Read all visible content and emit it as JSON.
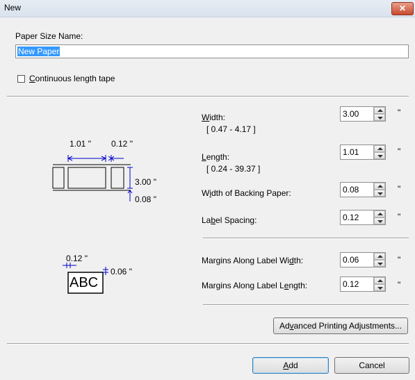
{
  "window": {
    "title": "New",
    "close_glyph": "✕"
  },
  "form": {
    "paper_size_name_label": "Paper Size Name:",
    "paper_size_name_value": "New Paper",
    "continuous_tape": {
      "label_pre": "",
      "label_u": "C",
      "label_post": "ontinuous length tape",
      "checked": false
    }
  },
  "fields": {
    "width": {
      "label_u": "W",
      "label_post": "idth:",
      "range": "[ 0.47 - 4.17 ]",
      "value": "3.00",
      "unit": "\""
    },
    "length": {
      "label_u": "L",
      "label_post": "ength:",
      "range": "[ 0.24 - 39.37 ]",
      "value": "1.01",
      "unit": "\""
    },
    "backing": {
      "label_pre": "W",
      "label_u": "i",
      "label_post": "dth of Backing Paper:",
      "value": "0.08",
      "unit": "\""
    },
    "spacing": {
      "label_pre": "La",
      "label_u": "b",
      "label_post": "el Spacing:",
      "value": "0.12",
      "unit": "\""
    },
    "margin_width": {
      "label_pre": "Margins Along Label Wi",
      "label_u": "d",
      "label_post": "th:",
      "value": "0.06",
      "unit": "\""
    },
    "margin_length": {
      "label_pre": "Margins Along Label L",
      "label_u": "e",
      "label_post": "ngth:",
      "value": "0.12",
      "unit": "\""
    }
  },
  "diagram": {
    "dim_length": "1.01 \"",
    "dim_spacing": "0.12 \"",
    "dim_width": "3.00 \"",
    "dim_backing": "0.08 \"",
    "dim_margin_w": "0.12 \"",
    "dim_margin_l": "0.06 \"",
    "sample_text": "ABC"
  },
  "buttons": {
    "advanced": {
      "pre": "Ad",
      "u": "v",
      "post": "anced Printing Adjustments..."
    },
    "add": {
      "pre": "",
      "u": "A",
      "post": "dd"
    },
    "cancel": "Cancel"
  },
  "colors": {
    "accent_blue": "#3399ff",
    "dimension_blue": "#0000cc"
  }
}
